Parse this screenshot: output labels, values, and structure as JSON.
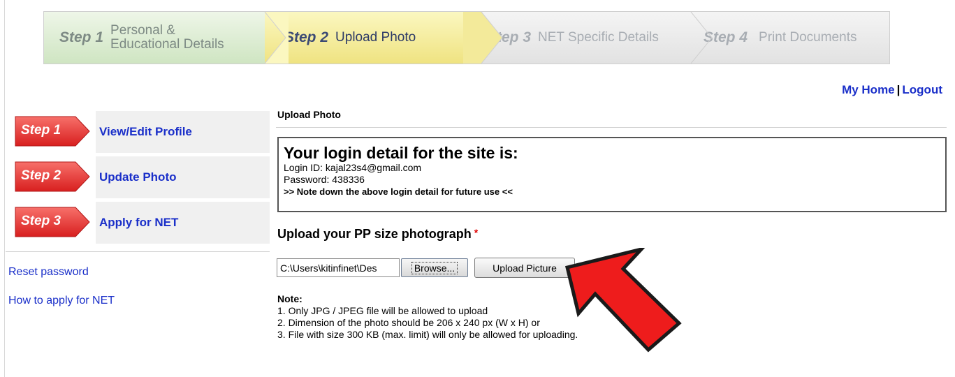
{
  "wizard": {
    "steps": [
      {
        "num": "Step 1",
        "label": "Personal &\nEducational Details"
      },
      {
        "num": "Step 2",
        "label": "Upload Photo"
      },
      {
        "num": "Step 3",
        "label": "NET Specific Details"
      },
      {
        "num": "Step 4",
        "label": "Print Documents"
      }
    ],
    "active_step": 2
  },
  "header": {
    "my_home": "My Home",
    "separator": "|",
    "logout": "Logout"
  },
  "sidebar": {
    "steps": [
      {
        "badge": "Step 1",
        "link": "View/Edit Profile"
      },
      {
        "badge": "Step 2",
        "link": "Update Photo"
      },
      {
        "badge": "Step 3",
        "link": "Apply for NET"
      }
    ],
    "links": [
      "Reset password",
      "How to apply for NET"
    ]
  },
  "main": {
    "title": "Upload Photo",
    "login_box": {
      "heading": "Your login detail for the site is:",
      "login_id": "Login ID: kajal23s4@gmail.com",
      "password": "Password: 438336",
      "note": ">> Note down the above login detail for future use <<"
    },
    "upload_heading": "Upload your PP size photograph",
    "required_mark": "*",
    "file_value": "C:\\Users\\kitinfinet\\Des",
    "browse_label": "Browse...",
    "upload_label": "Upload Picture",
    "notes": {
      "title": "Note:",
      "items": [
        "1. Only JPG / JPEG file will be allowed to upload",
        "2. Dimension of the photo should be 206 x 240 px (W x H) or",
        "3. File with size 300 KB (max. limit) will only be allowed for uploading."
      ]
    }
  },
  "colors": {
    "link": "#1a2fc9",
    "badge_red": "#e8312f",
    "arrow_red": "#ee1c1c",
    "step1_green": "#cfe5c2",
    "step2_yellow": "#efe381"
  },
  "icons": {
    "pointer_arrow": "red-pointer-arrow-icon"
  }
}
